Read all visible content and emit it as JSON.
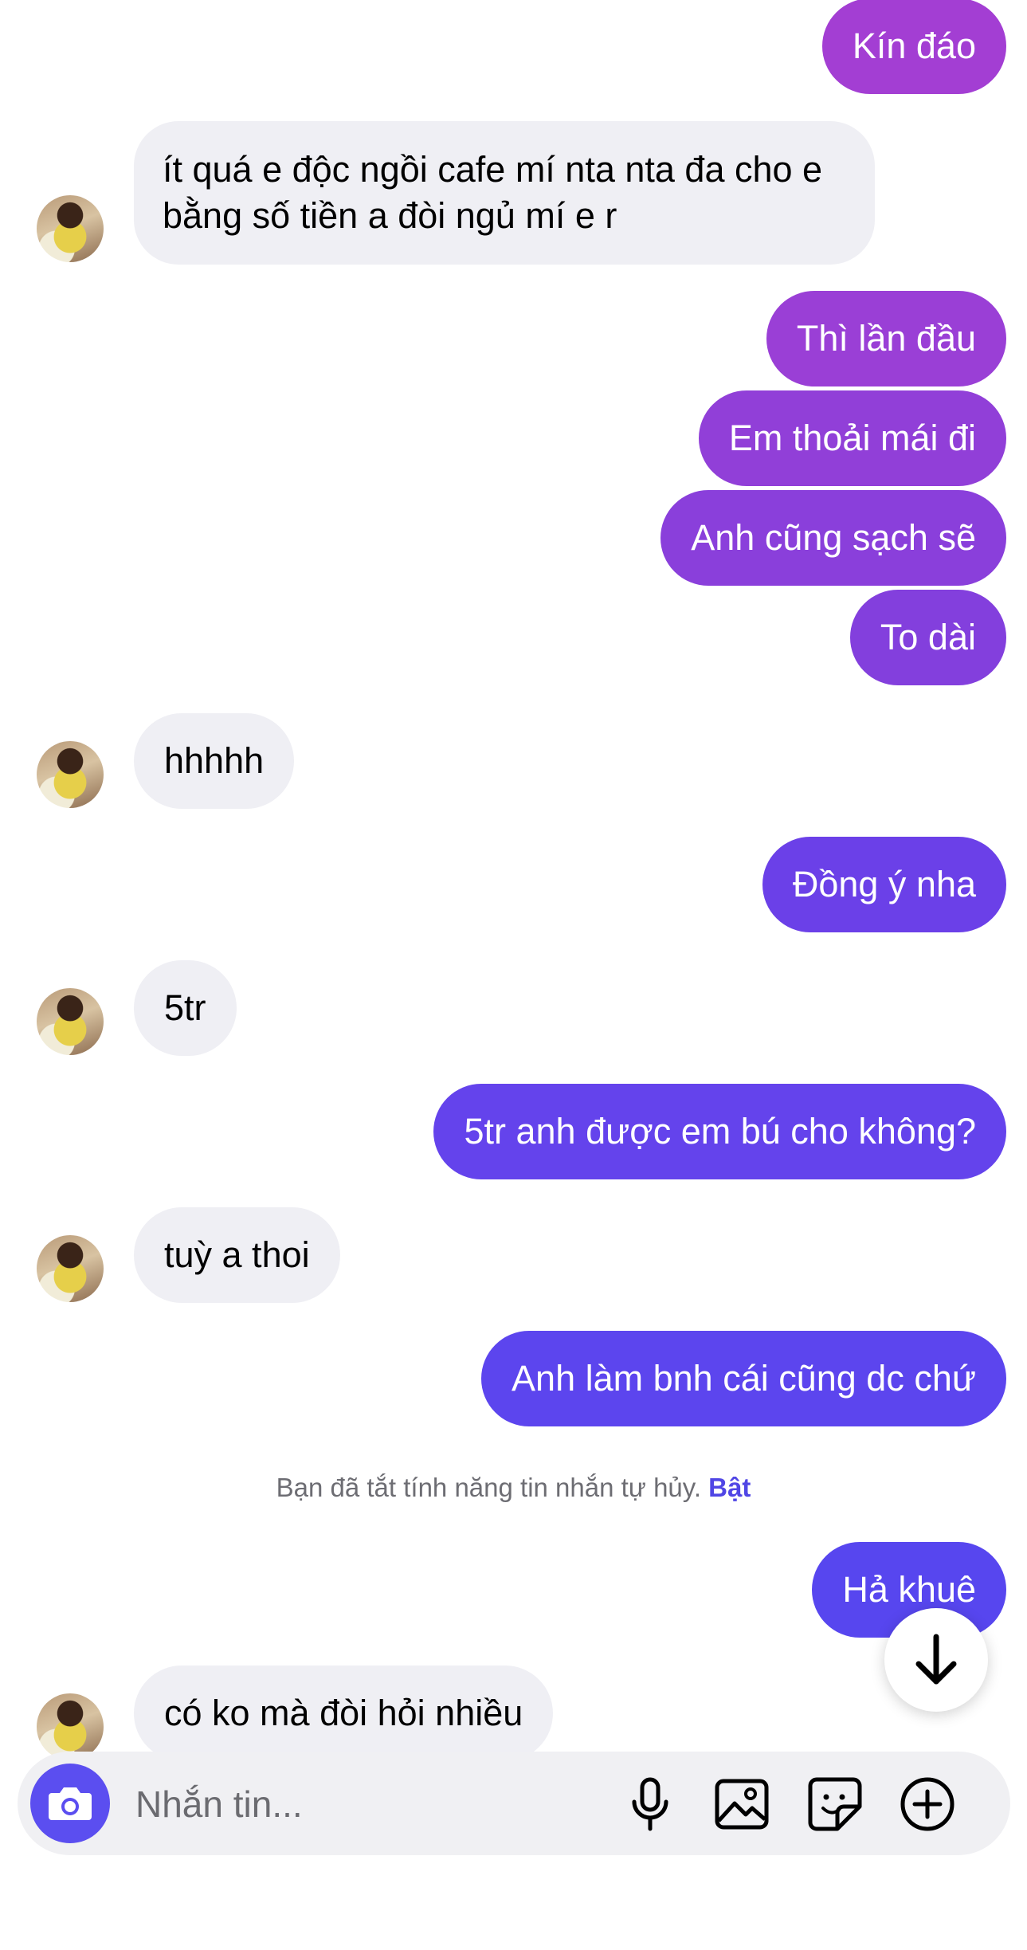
{
  "colors": {
    "outgoing_purple": "#9b3fd4",
    "outgoing_violet": "#6a3ee9",
    "outgoing_indigo": "#5746ef",
    "incoming_bg": "#efeff4",
    "accent": "#5046e5"
  },
  "messages": [
    {
      "direction": "out",
      "text": "Kín đáo"
    },
    {
      "direction": "in",
      "text": "ít quá e độc ngồi cafe mí nta nta đa cho e bằng số tiền a đòi ngủ mí e r"
    },
    {
      "direction": "out",
      "text": "Thì lần đầu"
    },
    {
      "direction": "out",
      "text": "Em thoải mái đi"
    },
    {
      "direction": "out",
      "text": "Anh cũng sạch sẽ"
    },
    {
      "direction": "out",
      "text": "To dài"
    },
    {
      "direction": "in",
      "text": "hhhhh"
    },
    {
      "direction": "out",
      "text": "Đồng ý nha"
    },
    {
      "direction": "in",
      "text": "5tr"
    },
    {
      "direction": "out",
      "text": "5tr anh được em bú cho không?"
    },
    {
      "direction": "in",
      "text": "tuỳ a thoi"
    },
    {
      "direction": "out",
      "text": "Anh làm bnh cái cũng dc chứ"
    },
    {
      "direction": "out",
      "text": "Hả khuê"
    },
    {
      "direction": "in",
      "text": "có ko mà đòi hỏi nhiều"
    }
  ],
  "notice": {
    "text": "Bạn đã tắt tính năng tin nhắn tự hủy.",
    "action": "Bật"
  },
  "composer": {
    "placeholder": "Nhắn tin...",
    "icons": [
      "camera-icon",
      "microphone-icon",
      "image-icon",
      "sticker-icon",
      "plus-icon"
    ]
  },
  "scroll_button_icon": "arrow-down-icon"
}
